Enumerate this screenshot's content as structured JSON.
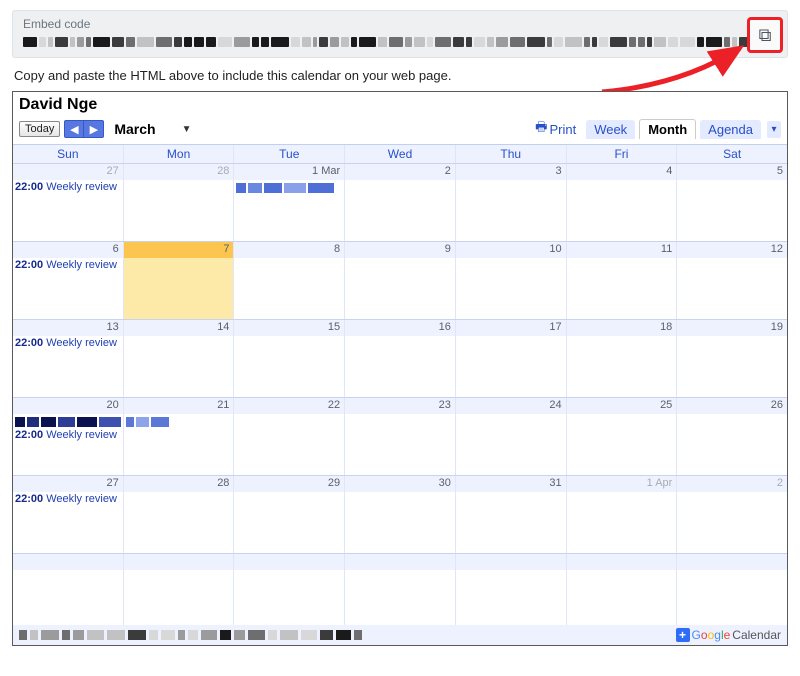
{
  "embed": {
    "label": "Embed code",
    "help_text": "Copy and paste the HTML above to include this calendar on your web page."
  },
  "calendar": {
    "title": "David Nge",
    "today_label": "Today",
    "month_label": "March",
    "print_label": "Print",
    "views": {
      "week": "Week",
      "month": "Month",
      "agenda": "Agenda"
    },
    "days_of_week": [
      "Sun",
      "Mon",
      "Tue",
      "Wed",
      "Thu",
      "Fri",
      "Sat"
    ],
    "weeks": [
      {
        "cells": [
          {
            "label": "27",
            "other": true,
            "events": [
              {
                "time": "22:00",
                "title": "Weekly review"
              }
            ]
          },
          {
            "label": "28",
            "other": true
          },
          {
            "label": "1 Mar",
            "allday": true
          },
          {
            "label": "2"
          },
          {
            "label": "3"
          },
          {
            "label": "4"
          },
          {
            "label": "5"
          }
        ]
      },
      {
        "cells": [
          {
            "label": "6",
            "events": [
              {
                "time": "22:00",
                "title": "Weekly review"
              }
            ]
          },
          {
            "label": "7",
            "highlight": true
          },
          {
            "label": "8"
          },
          {
            "label": "9"
          },
          {
            "label": "10"
          },
          {
            "label": "11"
          },
          {
            "label": "12"
          }
        ]
      },
      {
        "cells": [
          {
            "label": "13",
            "events": [
              {
                "time": "22:00",
                "title": "Weekly review"
              }
            ]
          },
          {
            "label": "14"
          },
          {
            "label": "15"
          },
          {
            "label": "16"
          },
          {
            "label": "17"
          },
          {
            "label": "18"
          },
          {
            "label": "19"
          }
        ]
      },
      {
        "cells": [
          {
            "label": "20",
            "allday_dark": true,
            "events": [
              {
                "time": "22:00",
                "title": "Weekly review"
              }
            ]
          },
          {
            "label": "21",
            "allday_light": true
          },
          {
            "label": "22"
          },
          {
            "label": "23"
          },
          {
            "label": "24"
          },
          {
            "label": "25"
          },
          {
            "label": "26"
          }
        ]
      },
      {
        "cells": [
          {
            "label": "27",
            "events": [
              {
                "time": "22:00",
                "title": "Weekly review"
              }
            ]
          },
          {
            "label": "28"
          },
          {
            "label": "29"
          },
          {
            "label": "30"
          },
          {
            "label": "31"
          },
          {
            "label": "1 Apr",
            "other": true
          },
          {
            "label": "2",
            "other": true
          }
        ]
      },
      {
        "cells": [
          {
            "label": ""
          },
          {
            "label": ""
          },
          {
            "label": ""
          },
          {
            "label": ""
          },
          {
            "label": ""
          },
          {
            "label": ""
          },
          {
            "label": ""
          }
        ]
      }
    ],
    "branding": {
      "google": "Google",
      "calendar": "Calendar"
    }
  }
}
